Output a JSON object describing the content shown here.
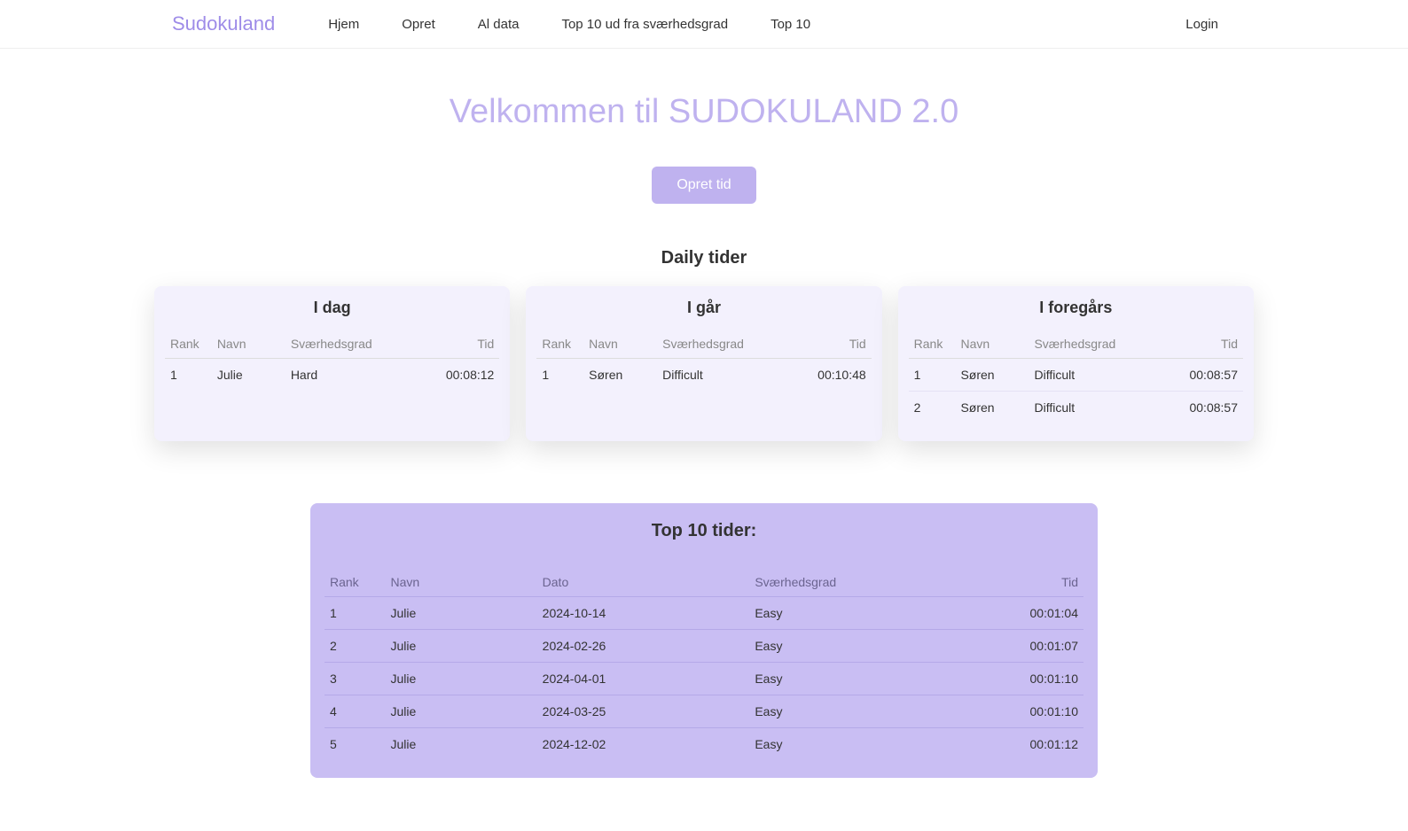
{
  "brand": "Sudokuland",
  "nav": {
    "items": [
      "Hjem",
      "Opret",
      "Al data",
      "Top 10 ud fra sværhedsgrad",
      "Top 10"
    ],
    "login": "Login"
  },
  "hero": {
    "title": "Velkommen til SUDOKULAND 2.0"
  },
  "cta": {
    "label": "Opret tid"
  },
  "daily": {
    "heading": "Daily tider",
    "cards": [
      {
        "title": "I dag",
        "headers": {
          "rank": "Rank",
          "name": "Navn",
          "difficulty": "Sværhedsgrad",
          "time": "Tid"
        },
        "rows": [
          {
            "rank": "1",
            "name": "Julie",
            "difficulty": "Hard",
            "time": "00:08:12"
          }
        ]
      },
      {
        "title": "I går",
        "headers": {
          "rank": "Rank",
          "name": "Navn",
          "difficulty": "Sværhedsgrad",
          "time": "Tid"
        },
        "rows": [
          {
            "rank": "1",
            "name": "Søren",
            "difficulty": "Difficult",
            "time": "00:10:48"
          }
        ]
      },
      {
        "title": "I foregårs",
        "headers": {
          "rank": "Rank",
          "name": "Navn",
          "difficulty": "Sværhedsgrad",
          "time": "Tid"
        },
        "rows": [
          {
            "rank": "1",
            "name": "Søren",
            "difficulty": "Difficult",
            "time": "00:08:57"
          },
          {
            "rank": "2",
            "name": "Søren",
            "difficulty": "Difficult",
            "time": "00:08:57"
          }
        ]
      }
    ]
  },
  "top10": {
    "heading": "Top 10 tider:",
    "headers": {
      "rank": "Rank",
      "name": "Navn",
      "date": "Dato",
      "difficulty": "Sværhedsgrad",
      "time": "Tid"
    },
    "rows": [
      {
        "rank": "1",
        "name": "Julie",
        "date": "2024-10-14",
        "difficulty": "Easy",
        "time": "00:01:04"
      },
      {
        "rank": "2",
        "name": "Julie",
        "date": "2024-02-26",
        "difficulty": "Easy",
        "time": "00:01:07"
      },
      {
        "rank": "3",
        "name": "Julie",
        "date": "2024-04-01",
        "difficulty": "Easy",
        "time": "00:01:10"
      },
      {
        "rank": "4",
        "name": "Julie",
        "date": "2024-03-25",
        "difficulty": "Easy",
        "time": "00:01:10"
      },
      {
        "rank": "5",
        "name": "Julie",
        "date": "2024-12-02",
        "difficulty": "Easy",
        "time": "00:01:12"
      }
    ]
  }
}
